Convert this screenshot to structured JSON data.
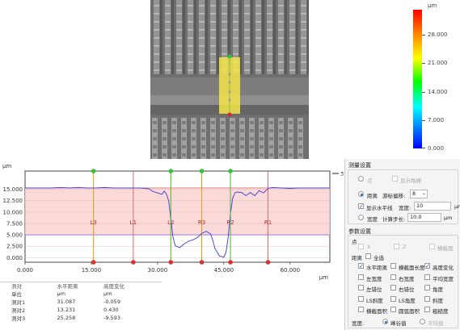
{
  "colorbar": {
    "unit": "μm",
    "labels": [
      "28.000",
      "21.000",
      "14.000",
      "7.000",
      "0.000"
    ],
    "gradient": [
      "#ff0000",
      "#ff8000",
      "#ffff00",
      "#00ff00",
      "#00ffff",
      "#0000ff"
    ]
  },
  "chart_data": {
    "type": "line",
    "ylabel": "μm",
    "xlabel": "μm",
    "xlim": [
      0,
      69
    ],
    "ylim": [
      -1,
      19
    ],
    "x_ticks": [
      "0.000",
      "15.000",
      "30.000",
      "45.000",
      "60.000"
    ],
    "y_ticks": [
      "0.000",
      "2.500",
      "5.000",
      "7.500",
      "10.000",
      "12.500",
      "15.000"
    ],
    "legend_label": "3",
    "series": [
      {
        "color": "#3b3bd8",
        "x": [
          0,
          2,
          4,
          6,
          8,
          10,
          12,
          14,
          16,
          18,
          20,
          22,
          24,
          26,
          28,
          29,
          30,
          31,
          31.5,
          32,
          32.5,
          33,
          33.5,
          34,
          35,
          36,
          37,
          38,
          39,
          40,
          41,
          42,
          42.5,
          43,
          44,
          45,
          45.5,
          46,
          46.5,
          47,
          47.5,
          48,
          49,
          50,
          51,
          52,
          53,
          54,
          55,
          56,
          58,
          60,
          62,
          64,
          66,
          68,
          69
        ],
        "y": [
          15.3,
          15.3,
          15.3,
          15.3,
          15.4,
          15.3,
          15.4,
          15.3,
          15.3,
          15.4,
          15.3,
          15.3,
          15.3,
          15.3,
          15.1,
          14.5,
          14.2,
          13.9,
          14.6,
          14.0,
          12.5,
          8.5,
          4.5,
          2.6,
          2.2,
          3.0,
          3.6,
          3.9,
          4.4,
          5.3,
          5.8,
          5.2,
          3.8,
          2.0,
          0.4,
          0.1,
          1.2,
          4.6,
          9.8,
          13.0,
          14.2,
          14.4,
          14.3,
          13.6,
          14.3,
          13.6,
          14.7,
          14.2,
          15.2,
          15.4,
          15.3,
          15.2,
          15.3,
          15.3,
          15.3,
          15.3,
          15.3
        ]
      }
    ],
    "shaded_band": [
      5.0,
      15.3
    ],
    "guide_lines": [
      {
        "label": "L3",
        "x": 15.5,
        "color": "#d8a000"
      },
      {
        "label": "L1",
        "x": 24.5,
        "color": "#d07070"
      },
      {
        "label": "L2",
        "x": 33.0,
        "color": "#d8a000"
      },
      {
        "label": "R3",
        "x": 40.0,
        "color": "#d8a000"
      },
      {
        "label": "R2",
        "x": 46.5,
        "color": "#d07070"
      },
      {
        "label": "R1",
        "x": 55.0,
        "color": "#d07070"
      }
    ],
    "green_markers_x": [
      15.5,
      33.0,
      40.0,
      46.5
    ],
    "red_markers_x": [
      15.5,
      24.5,
      33.0,
      40.0,
      46.5,
      55.0
    ]
  },
  "table": {
    "headers": [
      "测对",
      "水平距离",
      "高度变化"
    ],
    "rows": [
      [
        "单位",
        "μm",
        "μm"
      ],
      [
        "测对1",
        "31.087",
        "-0.059"
      ],
      [
        "测对2",
        "13.231",
        "0.430"
      ],
      [
        "测对3",
        "25.258",
        "-9.593"
      ]
    ]
  },
  "settings": {
    "section1_title": "测量设置",
    "point_label": "点",
    "show_grid_label": "显示格栅",
    "distance_label": "距离",
    "search_step_label": "游标偏移:",
    "search_step_value": "8",
    "show_hline_label": "显示水平线",
    "width_label": "宽度:",
    "width_value": "10",
    "unit_um": "μm",
    "height_label": "宽度",
    "calc_step_label": "计算步长:",
    "calc_step_value": "10.0",
    "section2_title": "参数设置",
    "point2_label": "点",
    "x_label": "X",
    "z_label": "Z",
    "cross_section_label": "横截面",
    "distance2_label": "距离",
    "all_select_label": "全选",
    "params": [
      [
        "水平距离",
        "横截面长度",
        "高度变化"
      ],
      [
        "左宽度",
        "右宽度",
        "平均宽度"
      ],
      [
        "左错位",
        "右错位",
        "角度"
      ],
      [
        "LS斜度",
        "LS角度",
        "斜度"
      ],
      [
        "横截面积",
        "圆弧面积",
        "粗糙度"
      ]
    ],
    "params_checked": [
      [
        true,
        false,
        true
      ],
      [
        false,
        false,
        false
      ],
      [
        false,
        false,
        false
      ],
      [
        false,
        false,
        false
      ],
      [
        false,
        false,
        false
      ]
    ],
    "area_label": "宽度:",
    "mode_a_label": "峰谷值",
    "mode_b_label": "平均值"
  }
}
